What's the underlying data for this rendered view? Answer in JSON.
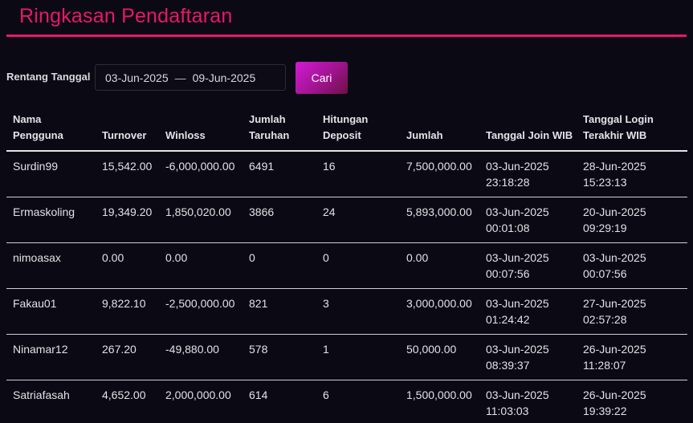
{
  "page_title": "Ringkasan Pendaftaran",
  "filter": {
    "label": "Rentang Tanggal",
    "date_from": "03-Jun-2025",
    "separator": "—",
    "date_to": "09-Jun-2025",
    "search_label": "Cari"
  },
  "table": {
    "headers": [
      "Nama\nPengguna",
      "Turnover",
      "Winloss",
      "Jumlah\nTaruhan",
      "Hitungan\nDeposit",
      "Jumlah",
      "Tanggal Join WIB",
      "Tanggal Login\nTerakhir WIB"
    ],
    "rows": [
      {
        "username": "Surdin99",
        "turnover": "15,542.00",
        "winloss": "-6,000,000.00",
        "bets": "6491",
        "deposit_count": "16",
        "amount": "7,500,000.00",
        "join_date": "03-Jun-2025",
        "join_time": "23:18:28",
        "login_date": "28-Jun-2025",
        "login_time": "15:23:13"
      },
      {
        "username": "Ermaskoling",
        "turnover": "19,349.20",
        "winloss": "1,850,020.00",
        "bets": "3866",
        "deposit_count": "24",
        "amount": "5,893,000.00",
        "join_date": "03-Jun-2025",
        "join_time": "00:01:08",
        "login_date": "20-Jun-2025",
        "login_time": "09:29:19"
      },
      {
        "username": "nimoasax",
        "turnover": "0.00",
        "winloss": "0.00",
        "bets": "0",
        "deposit_count": "0",
        "amount": "0.00",
        "join_date": "03-Jun-2025",
        "join_time": "00:07:56",
        "login_date": "03-Jun-2025",
        "login_time": "00:07:56"
      },
      {
        "username": "Fakau01",
        "turnover": "9,822.10",
        "winloss": "-2,500,000.00",
        "bets": "821",
        "deposit_count": "3",
        "amount": "3,000,000.00",
        "join_date": "03-Jun-2025",
        "join_time": "01:24:42",
        "login_date": "27-Jun-2025",
        "login_time": "02:57:28"
      },
      {
        "username": "Ninamar12",
        "turnover": "267.20",
        "winloss": "-49,880.00",
        "bets": "578",
        "deposit_count": "1",
        "amount": "50,000.00",
        "join_date": "03-Jun-2025",
        "join_time": "08:39:37",
        "login_date": "26-Jun-2025",
        "login_time": "11:28:07"
      },
      {
        "username": "Satriafasah",
        "turnover": "4,652.00",
        "winloss": "2,000,000.00",
        "bets": "614",
        "deposit_count": "6",
        "amount": "1,500,000.00",
        "join_date": "03-Jun-2025",
        "join_time": "11:03:03",
        "login_date": "26-Jun-2025",
        "login_time": "19:39:22"
      }
    ]
  },
  "colors": {
    "accent": "#e8176c",
    "button_gradient_start": "#d21ad5",
    "button_gradient_end": "#6e1046",
    "background": "#0b0a14"
  }
}
